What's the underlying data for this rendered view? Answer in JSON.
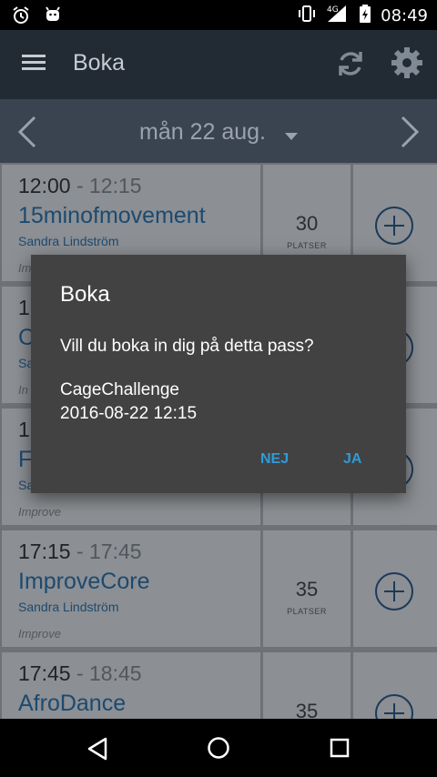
{
  "status": {
    "time": "08:49",
    "network": "4G"
  },
  "toolbar": {
    "title": "Boka"
  },
  "datebar": {
    "date": "mån 22 aug."
  },
  "sessions": [
    {
      "start": "12:00",
      "sep": " - ",
      "end": "12:15",
      "name": "15minofmovement",
      "trainer": "Sandra Lindström",
      "category": "Improve",
      "count": "30",
      "plats": "PLATSER"
    },
    {
      "start": "1",
      "sep": "",
      "end": "",
      "name": "C",
      "trainer": "Sa",
      "category": "In",
      "count": "",
      "plats": ""
    },
    {
      "start": "1",
      "sep": "",
      "end": "",
      "name": "F",
      "trainer": "Sa",
      "category": "Improve",
      "count": "",
      "plats": ""
    },
    {
      "start": "17:15",
      "sep": " - ",
      "end": "17:45",
      "name": "ImproveCore",
      "trainer": "Sandra Lindström",
      "category": "Improve",
      "count": "35",
      "plats": "PLATSER"
    },
    {
      "start": "17:45",
      "sep": " - ",
      "end": "18:45",
      "name": "AfroDance",
      "trainer": "",
      "category": "",
      "count": "35",
      "plats": ""
    }
  ],
  "dialog": {
    "title": "Boka",
    "message": "Vill du boka in dig på detta pass?",
    "class_name": "CageChallenge",
    "datetime": "2016-08-22 12:15",
    "no_label": "NEJ",
    "yes_label": "JA"
  },
  "colors": {
    "accent": "#2f9bd8",
    "toolbar": "#222b34",
    "datebar": "#3a4451"
  }
}
